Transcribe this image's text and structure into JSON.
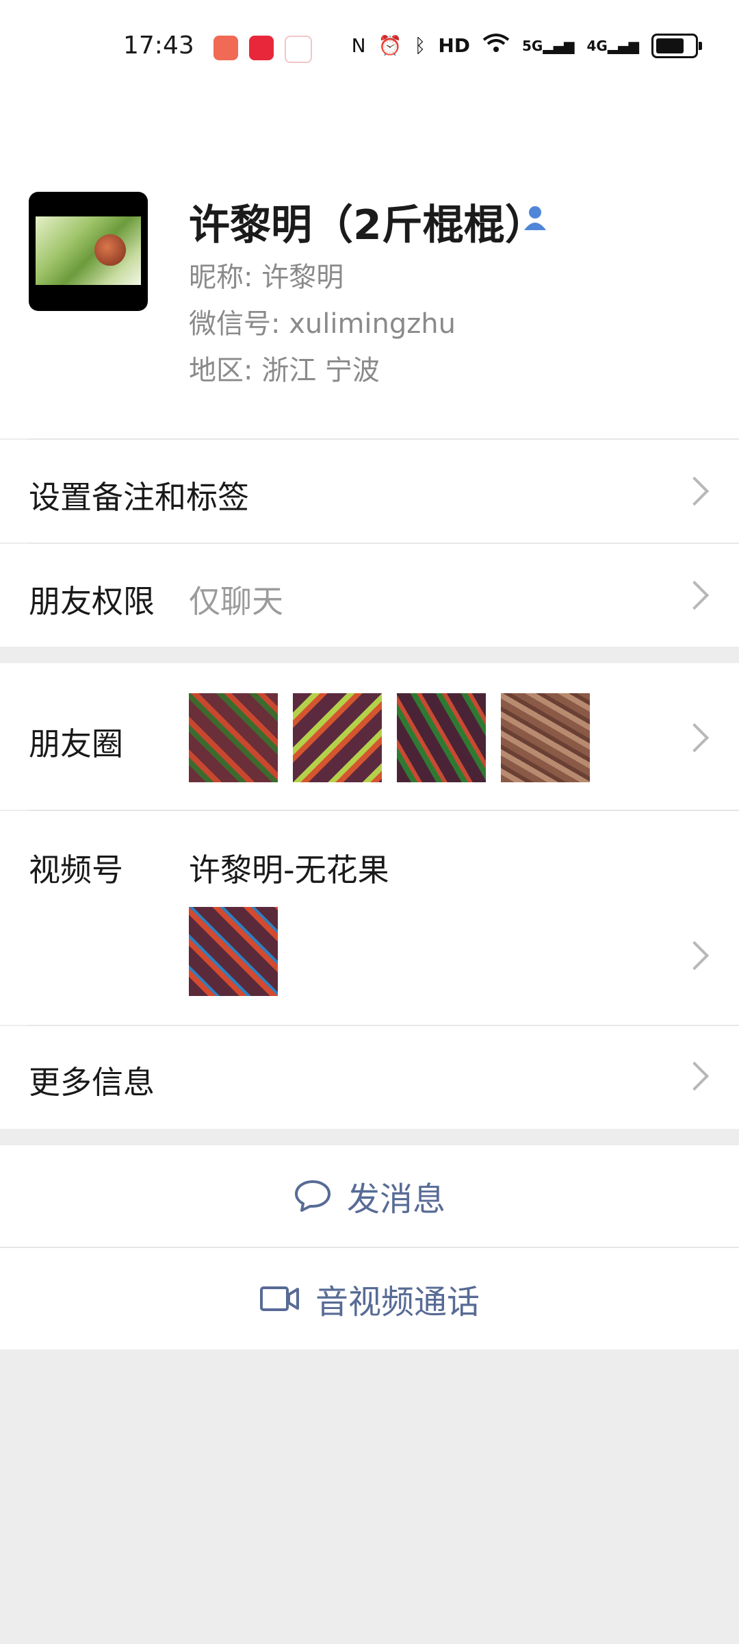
{
  "status": {
    "time": "17:43",
    "network": [
      "5G",
      "4G"
    ],
    "hd": "HD"
  },
  "nav": {
    "back_icon": "chevron-left-icon",
    "more_icon": "more-dots-icon"
  },
  "profile": {
    "name": "许黎明（2斤棍棍）",
    "nickname": "昵称:  许黎明",
    "wechat_id": "微信号:  xulimingzhu",
    "region": "地区:  浙江  宁波"
  },
  "rows": {
    "remark_label": "设置备注和标签",
    "permission_label": "朋友权限",
    "permission_value": "仅聊天",
    "moments_label": "朋友圈",
    "channels_label": "视频号",
    "channels_value": "许黎明-无花果",
    "more_info_label": "更多信息"
  },
  "actions": {
    "message_label": "发消息",
    "call_label": "音视频通话"
  },
  "colors": {
    "accent": "#576b95",
    "background": "#ededed",
    "card": "#ffffff",
    "verified_icon": "#4f86d9"
  }
}
